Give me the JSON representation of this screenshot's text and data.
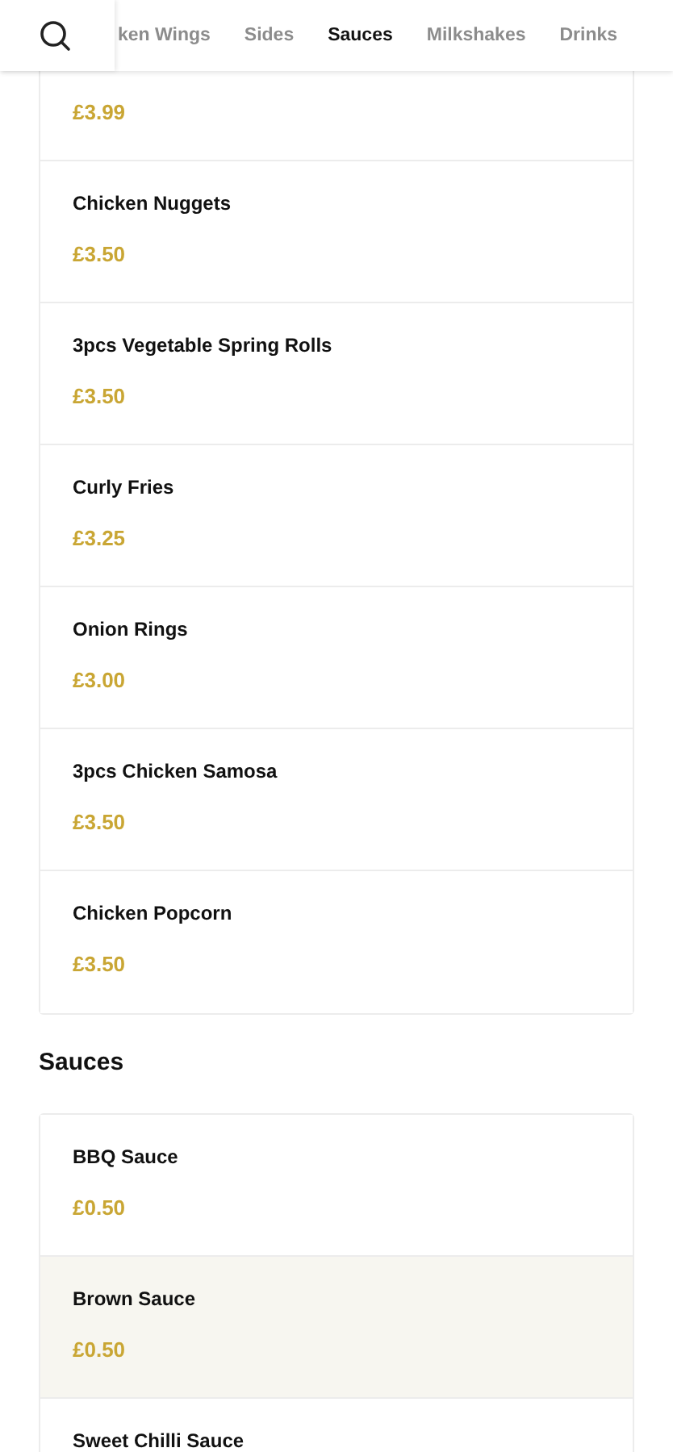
{
  "tabs": [
    {
      "label": "ken Wings",
      "selected": false
    },
    {
      "label": "Sides",
      "selected": false
    },
    {
      "label": "Sauces",
      "selected": true
    },
    {
      "label": "Milkshakes",
      "selected": false
    },
    {
      "label": "Drinks",
      "selected": false
    }
  ],
  "sections": [
    {
      "items": [
        {
          "price": "£3.99",
          "highlighted": false
        },
        {
          "name": "Chicken Nuggets",
          "price": "£3.50",
          "highlighted": false
        },
        {
          "name": "3pcs Vegetable Spring Rolls",
          "price": "£3.50",
          "highlighted": false
        },
        {
          "name": "Curly Fries",
          "price": "£3.25",
          "highlighted": false
        },
        {
          "name": "Onion Rings",
          "price": "£3.00",
          "highlighted": false
        },
        {
          "name": "3pcs Chicken Samosa",
          "price": "£3.50",
          "highlighted": false
        },
        {
          "name": "Chicken Popcorn",
          "price": "£3.50",
          "highlighted": false
        }
      ]
    },
    {
      "heading": "Sauces",
      "items": [
        {
          "name": "BBQ Sauce",
          "price": "£0.50",
          "highlighted": false
        },
        {
          "name": "Brown Sauce",
          "price": "£0.50",
          "highlighted": true
        },
        {
          "name": "Sweet Chilli Sauce",
          "highlighted": false
        }
      ]
    }
  ]
}
